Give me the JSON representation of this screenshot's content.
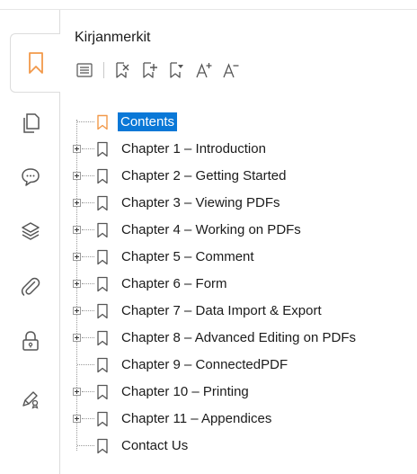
{
  "panel": {
    "title": "Kirjanmerkit"
  },
  "sidebar": {
    "items": [
      {
        "icon": "bookmark-icon",
        "active": true
      },
      {
        "icon": "pages-icon"
      },
      {
        "icon": "comment-icon"
      },
      {
        "icon": "layers-icon"
      },
      {
        "icon": "attachment-icon"
      },
      {
        "icon": "security-icon"
      },
      {
        "icon": "signature-icon"
      }
    ]
  },
  "toolbar": {
    "items": [
      "expand-list-icon",
      "delete-bookmark-icon",
      "add-bookmark-icon",
      "add-child-bookmark-icon",
      "increase-font-icon",
      "decrease-font-icon"
    ]
  },
  "bookmarks": [
    {
      "label": "Contents",
      "expandable": false,
      "selected": true
    },
    {
      "label": "Chapter 1 – Introduction",
      "expandable": true
    },
    {
      "label": "Chapter 2 – Getting Started",
      "expandable": true
    },
    {
      "label": "Chapter 3 – Viewing PDFs",
      "expandable": true
    },
    {
      "label": "Chapter 4 – Working on PDFs",
      "expandable": true
    },
    {
      "label": "Chapter 5 – Comment",
      "expandable": true
    },
    {
      "label": "Chapter 6 – Form",
      "expandable": true
    },
    {
      "label": "Chapter 7 – Data Import & Export",
      "expandable": true
    },
    {
      "label": "Chapter 8 – Advanced Editing on PDFs",
      "expandable": true
    },
    {
      "label": "Chapter 9 – ConnectedPDF",
      "expandable": false
    },
    {
      "label": "Chapter 10 – Printing",
      "expandable": true
    },
    {
      "label": "Chapter 11 – Appendices",
      "expandable": true
    },
    {
      "label": "Contact Us",
      "expandable": false
    }
  ],
  "colors": {
    "accent_orange": "#f2994a",
    "selection_blue": "#0a78d7",
    "icon_gray": "#555555"
  }
}
